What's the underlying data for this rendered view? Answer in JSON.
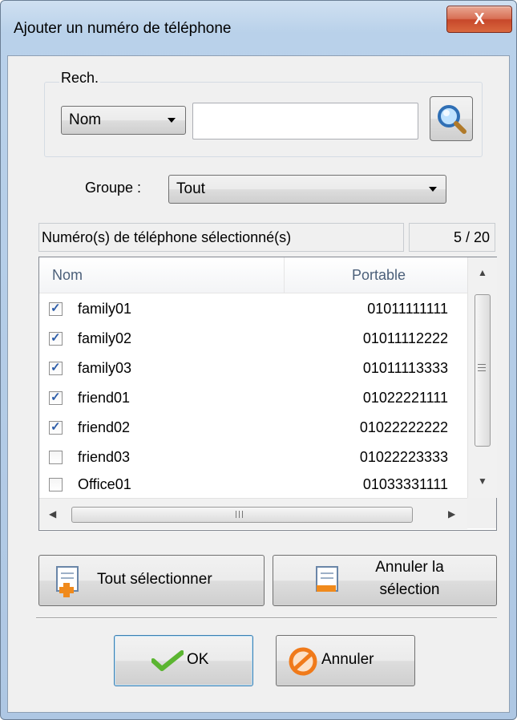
{
  "window": {
    "title": "Ajouter un numéro de téléphone",
    "close_label": "X"
  },
  "search": {
    "group_label": "Rech.",
    "field_selected": "Nom",
    "value": "",
    "button_icon": "magnifier-icon"
  },
  "group": {
    "label": "Groupe :",
    "selected": "Tout"
  },
  "selection_info": {
    "label": "Numéro(s) de téléphone sélectionné(s)",
    "count": "5 / 20"
  },
  "table": {
    "columns": [
      "Nom",
      "Portable"
    ],
    "rows": [
      {
        "checked": true,
        "name": "family01",
        "phone": "01011111111"
      },
      {
        "checked": true,
        "name": "family02",
        "phone": "01011112222"
      },
      {
        "checked": true,
        "name": "family03",
        "phone": "01011113333"
      },
      {
        "checked": true,
        "name": "friend01",
        "phone": "01022221111"
      },
      {
        "checked": true,
        "name": "friend02",
        "phone": "01022222222"
      },
      {
        "checked": false,
        "name": "friend03",
        "phone": "01022223333"
      },
      {
        "checked": false,
        "name": "Office01",
        "phone": "01033331111"
      }
    ]
  },
  "actions": {
    "select_all": "Tout sélectionner",
    "cancel_selection_line1": "Annuler la",
    "cancel_selection_line2": "sélection"
  },
  "footer": {
    "ok": "OK",
    "cancel": "Annuler"
  },
  "colors": {
    "title_bar": "#b9d1ea",
    "close_button": "#c7472a",
    "check": "#2c5ca8",
    "ok_icon": "#5bb531",
    "cancel_icon": "#f07a1a"
  }
}
